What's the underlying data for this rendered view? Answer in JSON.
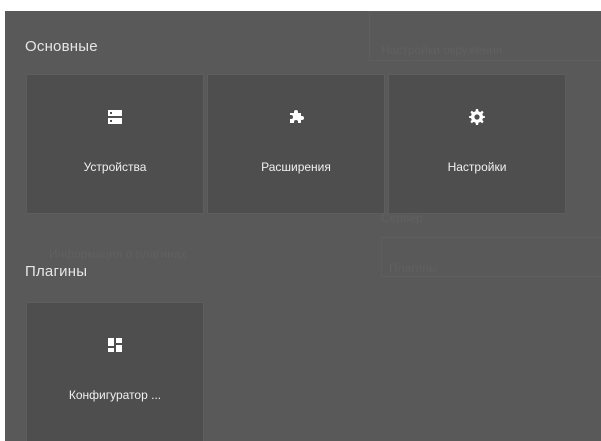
{
  "background": {
    "hints": [
      "Настройки окружения",
      "Сервер",
      "Информация о плагинах",
      "Плагины"
    ]
  },
  "sections": [
    {
      "title": "Основные",
      "tiles": [
        {
          "label": "Устройства",
          "icon": "devices-icon"
        },
        {
          "label": "Расширения",
          "icon": "puzzle-icon"
        },
        {
          "label": "Настройки",
          "icon": "gear-icon"
        }
      ]
    },
    {
      "title": "Плагины",
      "tiles": [
        {
          "label": "Конфигуратор ...",
          "icon": "dashboard-icon"
        }
      ]
    }
  ],
  "colors": {
    "overlay": "#595959",
    "tile": "#4e4e4e",
    "tile_border": "#5d5d5d",
    "text": "#ffffff"
  }
}
